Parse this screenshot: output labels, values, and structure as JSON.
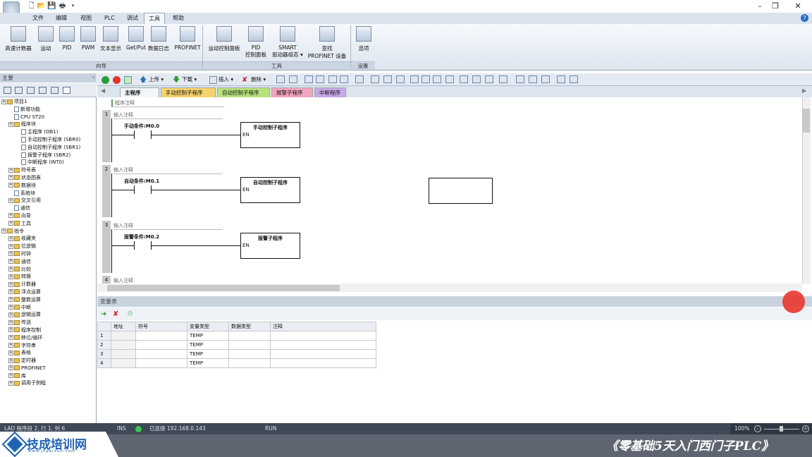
{
  "menu": [
    "文件",
    "编辑",
    "视图",
    "PLC",
    "调试",
    "工具",
    "帮助"
  ],
  "active_menu": "工具",
  "ribbon": {
    "groups": [
      {
        "label": "向导",
        "items": [
          "高速计数器",
          "运动",
          "PID",
          "PWM",
          "文本显示",
          "Get/Put",
          "数据日志",
          "PROFINET"
        ]
      },
      {
        "label": "工具",
        "items": [
          "运动控制面板",
          "PID\n控制面板",
          "SMART\n驱动器组态 ▾",
          "查找\nPROFINET 设备"
        ]
      },
      {
        "label": "设置",
        "items": [
          "选项"
        ]
      }
    ]
  },
  "left_panel": {
    "title": "主要",
    "tree": [
      {
        "t": "项目1",
        "d": 0,
        "k": "proj"
      },
      {
        "t": "新增功能",
        "d": 1,
        "k": "pg"
      },
      {
        "t": "CPU ST20",
        "d": 1,
        "k": "pg"
      },
      {
        "t": "程序块",
        "d": 1,
        "k": "fold"
      },
      {
        "t": "主程序 (OB1)",
        "d": 2,
        "k": "pg"
      },
      {
        "t": "手动控制子程序 (SBR0)",
        "d": 2,
        "k": "pg"
      },
      {
        "t": "自动控制子程序 (SBR1)",
        "d": 2,
        "k": "pg"
      },
      {
        "t": "报警子程序 (SBR2)",
        "d": 2,
        "k": "pg"
      },
      {
        "t": "中断程序 (INT0)",
        "d": 2,
        "k": "pg"
      },
      {
        "t": "符号表",
        "d": 1,
        "k": "fold"
      },
      {
        "t": "状态图表",
        "d": 1,
        "k": "fold"
      },
      {
        "t": "数据块",
        "d": 1,
        "k": "fold"
      },
      {
        "t": "系统块",
        "d": 1,
        "k": "pg"
      },
      {
        "t": "交叉引用",
        "d": 1,
        "k": "fold"
      },
      {
        "t": "通信",
        "d": 1,
        "k": "pg"
      },
      {
        "t": "向导",
        "d": 1,
        "k": "fold"
      },
      {
        "t": "工具",
        "d": 1,
        "k": "fold"
      },
      {
        "t": "指令",
        "d": 0,
        "k": "fold"
      },
      {
        "t": "收藏夹",
        "d": 1,
        "k": "fold"
      },
      {
        "t": "位逻辑",
        "d": 1,
        "k": "fold"
      },
      {
        "t": "时钟",
        "d": 1,
        "k": "fold"
      },
      {
        "t": "通信",
        "d": 1,
        "k": "fold"
      },
      {
        "t": "比较",
        "d": 1,
        "k": "fold"
      },
      {
        "t": "转换",
        "d": 1,
        "k": "fold"
      },
      {
        "t": "计数器",
        "d": 1,
        "k": "fold"
      },
      {
        "t": "浮点运算",
        "d": 1,
        "k": "fold"
      },
      {
        "t": "整数运算",
        "d": 1,
        "k": "fold"
      },
      {
        "t": "中断",
        "d": 1,
        "k": "fold"
      },
      {
        "t": "逻辑运算",
        "d": 1,
        "k": "fold"
      },
      {
        "t": "传送",
        "d": 1,
        "k": "fold"
      },
      {
        "t": "程序控制",
        "d": 1,
        "k": "fold"
      },
      {
        "t": "移位/循环",
        "d": 1,
        "k": "fold"
      },
      {
        "t": "字符串",
        "d": 1,
        "k": "fold"
      },
      {
        "t": "表格",
        "d": 1,
        "k": "fold"
      },
      {
        "t": "定时器",
        "d": 1,
        "k": "fold"
      },
      {
        "t": "PROFINET",
        "d": 1,
        "k": "fold"
      },
      {
        "t": "库",
        "d": 1,
        "k": "fold"
      },
      {
        "t": "调用子例程",
        "d": 1,
        "k": "fold"
      }
    ]
  },
  "editor_toolbar": {
    "upload": "上传",
    "download": "下载",
    "insert": "插入",
    "delete": "删除"
  },
  "tabs": [
    {
      "label": "主程序",
      "color": "#f4f6f9"
    },
    {
      "label": "手动控制子程序",
      "color": "#f6d36a"
    },
    {
      "label": "自动控制子程序",
      "color": "#b8e27a"
    },
    {
      "label": "报警子程序",
      "color": "#f3a3c0"
    },
    {
      "label": "中断程序",
      "color": "#c8a8e6"
    }
  ],
  "program_comment": "程序注释",
  "networks": [
    {
      "num": "1",
      "comment": "输入注释",
      "contact": "手动条件:M0.0",
      "box": "手动控制子程序",
      "en": "EN"
    },
    {
      "num": "2",
      "comment": "输入注释",
      "contact": "自动条件:M0.1",
      "box": "自动控制子程序",
      "en": "EN"
    },
    {
      "num": "3",
      "comment": "输入注释",
      "contact": "报警条件:M0.2",
      "box": "报警子程序",
      "en": "EN"
    },
    {
      "num": "4",
      "comment": "输入注释"
    }
  ],
  "var_table": {
    "title": "变量表",
    "headers": [
      "地址",
      "符号",
      "变量类型",
      "数据类型",
      "注释"
    ],
    "rows": [
      {
        "n": "1",
        "type": "TEMP"
      },
      {
        "n": "2",
        "type": "TEMP"
      },
      {
        "n": "3",
        "type": "TEMP"
      },
      {
        "n": "4",
        "type": "TEMP"
      }
    ]
  },
  "status": {
    "pos": "LAD 程序段 2, 行 1, 列 6",
    "mode": "INS",
    "conn": "已连接 192.168.0.143",
    "run": "RUN",
    "zoom": "100%"
  },
  "footer": {
    "logo": "技成培训网",
    "logo_sub": "www.jcpeixun.com",
    "course": "《零基础5天入门西门子PLC》"
  }
}
